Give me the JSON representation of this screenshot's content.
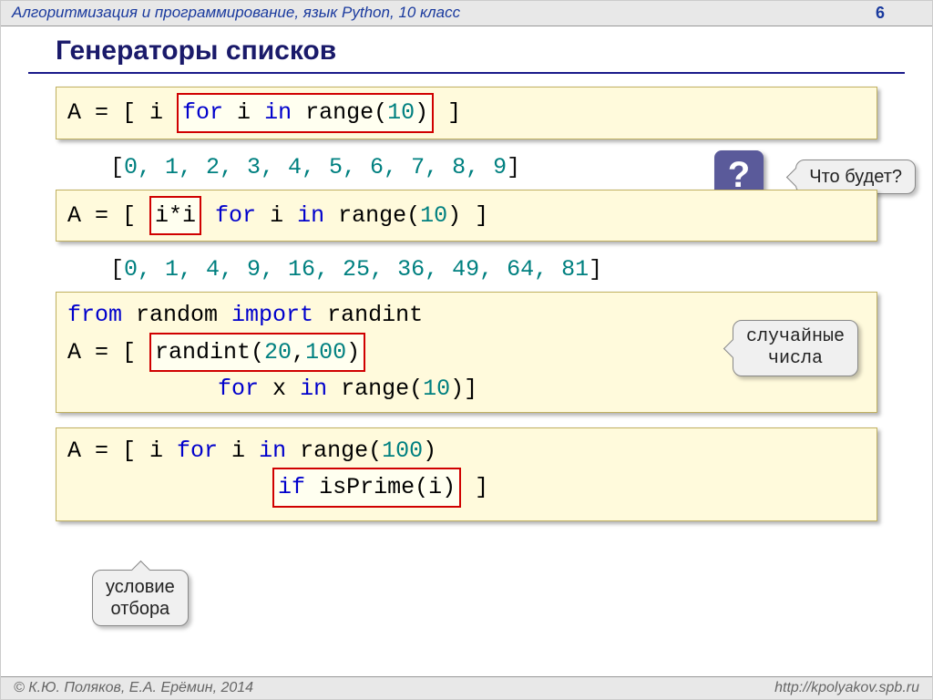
{
  "header": {
    "course": "Алгоритмизация и программирование, язык Python, 10 класс",
    "page_number": "6"
  },
  "title": "Генераторы списков",
  "blocks": {
    "code1": {
      "prefix": "A = [ i ",
      "highlight": "for i in range(10)",
      "suffix": " ]"
    },
    "output1": "[0, 1, 2, 3, 4, 5, 6, 7, 8, 9]",
    "code2": {
      "prefix": "A = [ ",
      "highlight": "i*i",
      "mid": " for i in range(",
      "num": "10",
      "suffix": ") ]"
    },
    "output2": "[0, 1, 4, 9, 16, 25, 36, 49, 64, 81]",
    "code3": {
      "line1_a": "from random import randint",
      "line2_a": "A = [ ",
      "line2_hl": "randint(20,100)",
      "line3_a": "for x in range(",
      "line3_num": "10",
      "line3_b": ")]"
    },
    "code4": {
      "line1_a": "A = [ i ",
      "line1_b": "for",
      "line1_c": " i ",
      "line1_d": "in",
      "line1_e": " range(",
      "line1_num": "100",
      "line1_f": ")",
      "line2_hl": "if isPrime(i)",
      "line2_suffix": " ]"
    }
  },
  "callouts": {
    "question": "?",
    "what_will_be": "Что будет?",
    "random_numbers": "случайные\nчисла",
    "selection_condition": "условие\nотбора"
  },
  "footer": {
    "copyright": "© К.Ю. Поляков, Е.А. Ерёмин, 2014",
    "url": "http://kpolyakov.spb.ru"
  }
}
